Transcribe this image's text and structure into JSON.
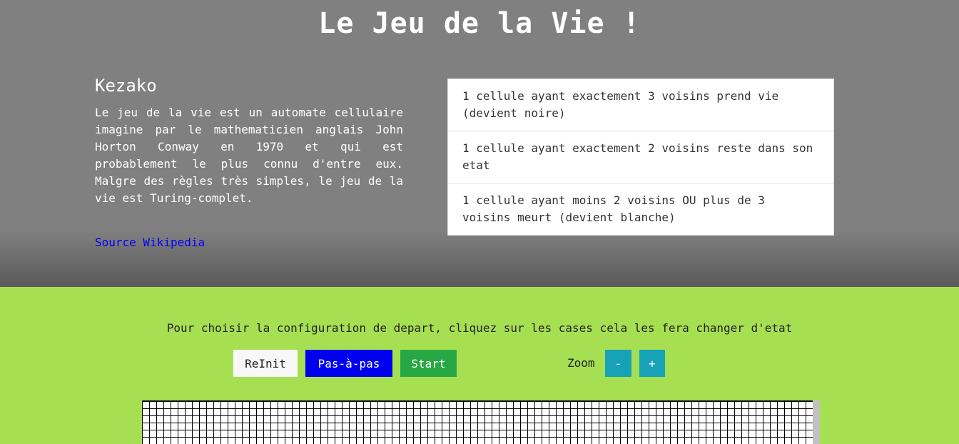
{
  "header": {
    "title": "Le Jeu de la Vie !",
    "kezako_heading": "Kezako",
    "description": "Le jeu de la vie est un automate cellulaire imagine par le mathematicien anglais John Horton Conway en 1970 et qui est probablement le plus connu d'entre eux. Malgre des règles très simples, le jeu de la vie est Turing-complet.",
    "source_link": "Source Wikipedia",
    "rules": [
      "1 cellule ayant exactement 3 voisins prend vie (devient noire)",
      "1 cellule ayant exactement 2 voisins reste dans son etat",
      "1 cellule ayant moins 2 voisins OU plus de 3 voisins meurt (devient blanche)"
    ]
  },
  "game": {
    "instructions": "Pour choisir la configuration de depart, cliquez sur les cases cela les fera changer d'etat",
    "reinit_label": "ReInit",
    "step_label": "Pas-à-pas",
    "start_label": "Start",
    "zoom_label": "Zoom",
    "zoom_out_label": "-",
    "zoom_in_label": "+"
  },
  "colors": {
    "header_bg": "#808080",
    "game_bg": "#a6e052",
    "step_button": "#0000ee",
    "start_button": "#28a745",
    "zoom_buttons": "#17a2b8",
    "link": "#0000ff"
  }
}
